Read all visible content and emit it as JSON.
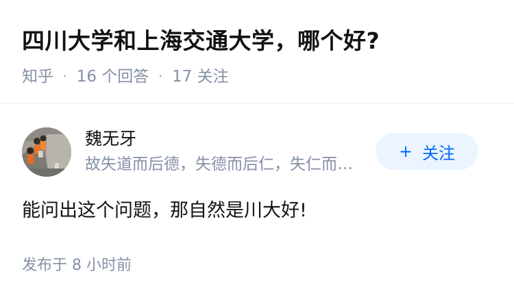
{
  "question": {
    "title": "四川大学和上海交通大学，哪个好?",
    "source": "知乎",
    "separator": "·",
    "answers_count": "16 个回答",
    "followers_count": "17 关注"
  },
  "answer": {
    "author": {
      "name": "魏无牙",
      "bio": "故失道而后德，失德而后仁，失仁而后义，失义而后礼",
      "avatar_icon": "avatar-photo"
    },
    "follow_button": {
      "icon": "+",
      "label": "关注"
    },
    "content": "能问出这个问题，那自然是川大好!",
    "published": "发布于 8 小时前"
  },
  "colors": {
    "primary_text": "#121212",
    "secondary_text": "#8590a6",
    "accent": "#0066ff",
    "button_bg": "#ebf5ff",
    "divider": "#ebebeb"
  }
}
